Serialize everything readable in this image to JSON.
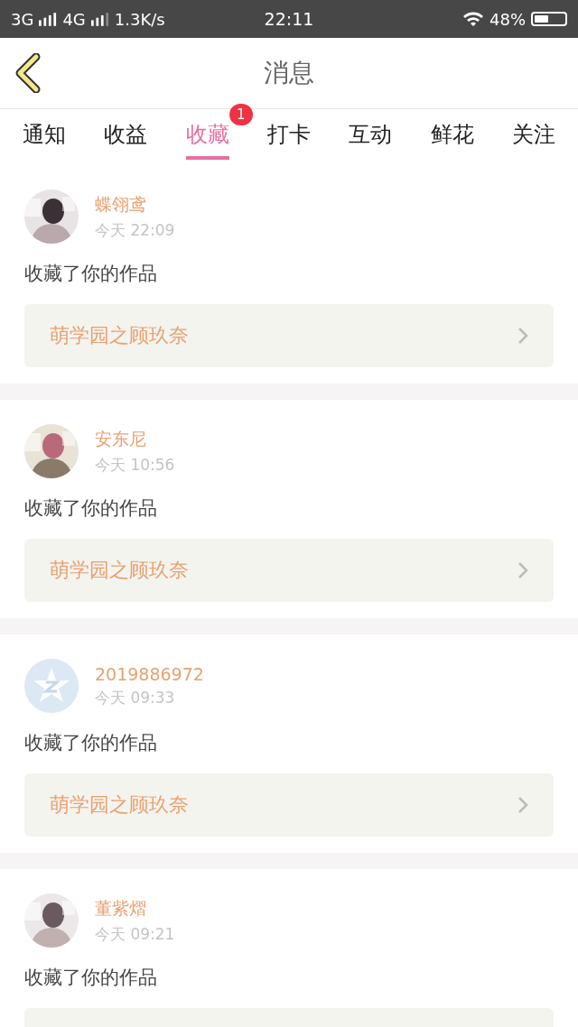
{
  "status_bar": {
    "network_1": "3G",
    "network_2": "4G",
    "speed": "1.3K/s",
    "time": "22:11",
    "battery": {
      "text": "48%",
      "level": 0.48
    }
  },
  "header": {
    "title": "消息"
  },
  "tabs": [
    {
      "label": "通知",
      "selected": false
    },
    {
      "label": "收益",
      "selected": false
    },
    {
      "label": "收藏",
      "selected": true,
      "badge": "1"
    },
    {
      "label": "打卡",
      "selected": false
    },
    {
      "label": "互动",
      "selected": false
    },
    {
      "label": "鲜花",
      "selected": false
    },
    {
      "label": "关注",
      "selected": false
    }
  ],
  "messages": [
    {
      "name": "蝶翎鸢",
      "time": "今天 22:09",
      "text": "收藏了你的作品",
      "work": "萌学园之顾玖奈"
    },
    {
      "name": "安东尼",
      "time": "今天 10:56",
      "text": "收藏了你的作品",
      "work": "萌学园之顾玖奈"
    },
    {
      "avatar": {
        "kind": "default"
      },
      "name": "2019886972",
      "time": "今天 09:33",
      "text": "收藏了你的作品",
      "work": "萌学园之顾玖奈"
    },
    {
      "name": "董紫熠",
      "time": "今天 09:21",
      "text": "收藏了你的作品"
    }
  ]
}
